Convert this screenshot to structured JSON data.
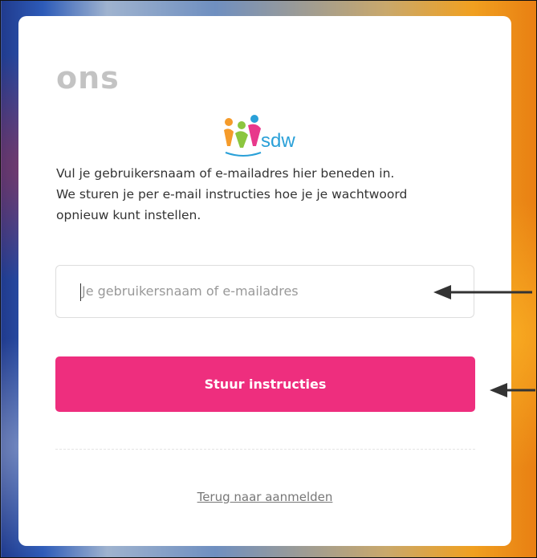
{
  "brand": {
    "name": "ons",
    "partner_logo_text": "sdw"
  },
  "instructions": [
    "Vul je gebruikersnaam of e-mailadres hier beneden in.",
    "We sturen je per e-mail instructies hoe je je wachtwoord",
    "opnieuw kunt instellen."
  ],
  "form": {
    "username_placeholder": "Je gebruikersnaam of e-mailadres",
    "submit_label": "Stuur instructies"
  },
  "links": {
    "back_label": "Terug naar aanmelden"
  },
  "colors": {
    "primary_button": "#ee2e7e",
    "logo_blue": "#2aa0d8",
    "brand_gray": "#c3c3c3"
  },
  "annotations": {
    "arrows": [
      "arrow-left-icon",
      "arrow-left-icon"
    ]
  }
}
